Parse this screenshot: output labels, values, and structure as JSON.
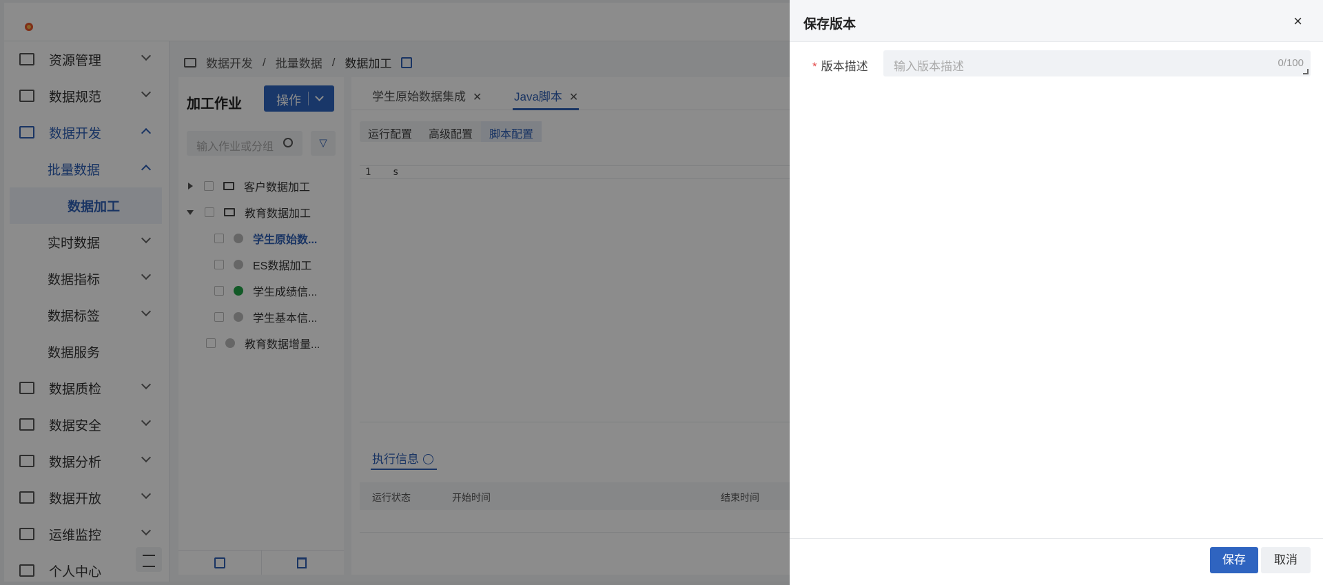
{
  "sidebar": {
    "items": [
      {
        "label": "资源管理",
        "icon": "server-icon",
        "expanded": false
      },
      {
        "label": "数据规范",
        "icon": "document-icon",
        "expanded": false
      },
      {
        "label": "数据开发",
        "icon": "code-icon",
        "expanded": true,
        "active": true
      },
      {
        "label": "批量数据",
        "expanded": true,
        "sub": true
      },
      {
        "label": "数据加工",
        "sub2": true,
        "selected": true
      },
      {
        "label": "实时数据",
        "sub": true
      },
      {
        "label": "数据指标",
        "sub": true
      },
      {
        "label": "数据标签",
        "sub": true
      },
      {
        "label": "数据服务",
        "sub": true
      },
      {
        "label": "数据质检",
        "icon": "inspect-icon"
      },
      {
        "label": "数据安全",
        "icon": "shield-icon"
      },
      {
        "label": "数据分析",
        "icon": "analysis-icon"
      },
      {
        "label": "数据开放",
        "icon": "open-icon"
      },
      {
        "label": "运维监控",
        "icon": "monitor-icon"
      },
      {
        "label": "个人中心",
        "icon": "user-icon"
      }
    ]
  },
  "breadcrumb": [
    "数据开发",
    "批量数据",
    "数据加工"
  ],
  "jobs": {
    "title": "加工作业",
    "op_button": "操作",
    "search_placeholder": "输入作业或分组",
    "tree": [
      {
        "label": "客户数据加工",
        "type": "folder",
        "expanded": false
      },
      {
        "label": "教育数据加工",
        "type": "folder",
        "expanded": true
      },
      {
        "label": "学生原始数...",
        "type": "job",
        "status": "gray",
        "selected": true
      },
      {
        "label": "ES数据加工",
        "type": "job",
        "status": "gray"
      },
      {
        "label": "学生成绩信...",
        "type": "job",
        "status": "green"
      },
      {
        "label": "学生基本信...",
        "type": "job",
        "status": "gray"
      },
      {
        "label": "教育数据增量...",
        "type": "job",
        "status": "gray"
      }
    ]
  },
  "editor": {
    "tabs": [
      {
        "label": "学生原始数据集成",
        "active": false
      },
      {
        "label": "Java脚本",
        "active": true
      }
    ],
    "subtabs": [
      "运行配置",
      "高级配置",
      "脚本配置"
    ],
    "active_subtab": "脚本配置",
    "code_lines": [
      {
        "num": "1",
        "text": "s"
      }
    ],
    "exec_tab": "执行信息",
    "exec_columns": [
      "运行状态",
      "开始时间",
      "结束时间"
    ]
  },
  "drawer": {
    "title": "保存版本",
    "close_glyph": "×",
    "field_label": "版本描述",
    "required_mark": "*",
    "placeholder": "输入版本描述",
    "counter": "0/100",
    "save": "保存",
    "cancel": "取消"
  },
  "colors": {
    "accent": "#2f64c0",
    "success": "#22a547",
    "required": "#e34d4d"
  }
}
